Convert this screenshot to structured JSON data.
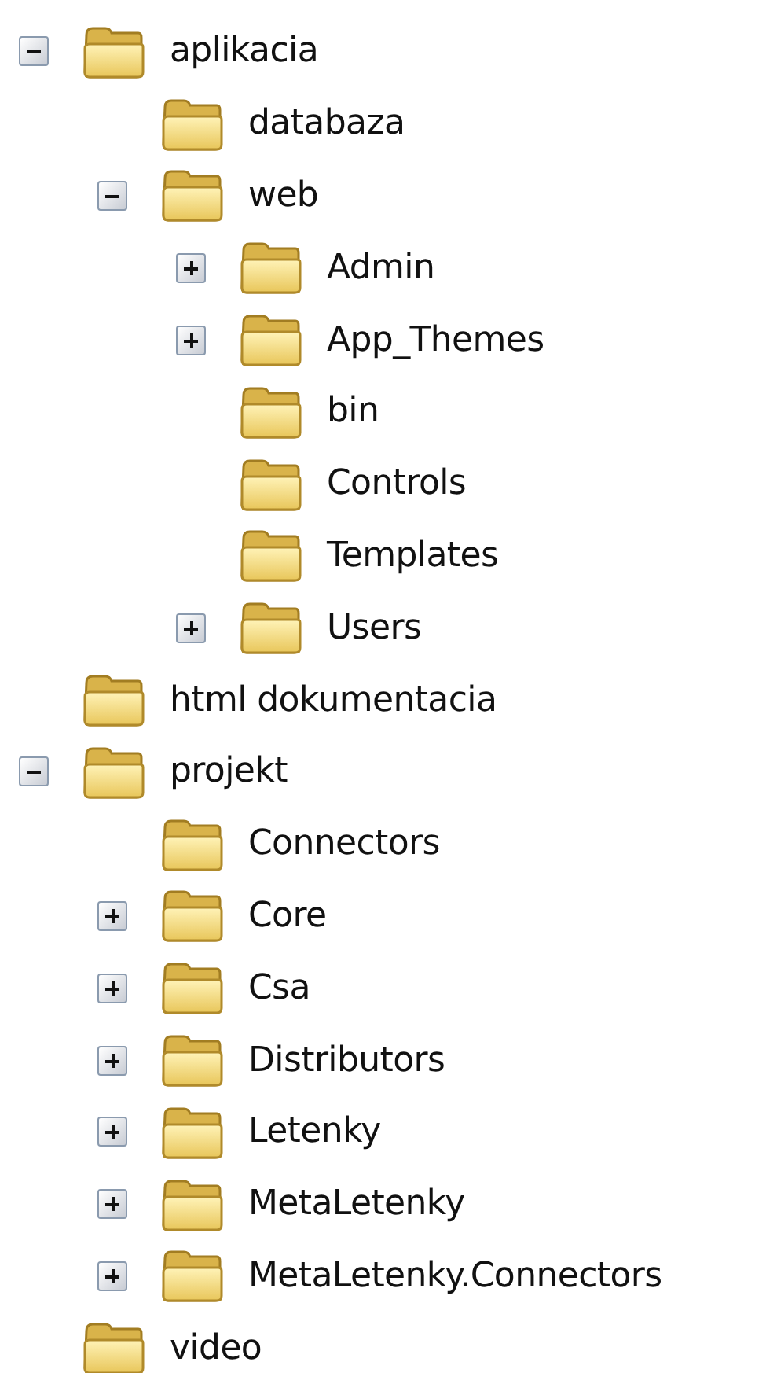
{
  "tree": [
    {
      "label": "aplikacia",
      "expanded": true,
      "children": [
        {
          "label": "databaza"
        },
        {
          "label": "web",
          "expanded": true,
          "children": [
            {
              "label": "Admin",
              "expanded": false
            },
            {
              "label": "App_Themes",
              "expanded": false
            },
            {
              "label": "bin"
            },
            {
              "label": "Controls"
            },
            {
              "label": "Templates"
            },
            {
              "label": "Users",
              "expanded": false
            }
          ]
        }
      ]
    },
    {
      "label": "html dokumentacia"
    },
    {
      "label": "projekt",
      "expanded": true,
      "children": [
        {
          "label": "Connectors"
        },
        {
          "label": "Core",
          "expanded": false
        },
        {
          "label": "Csa",
          "expanded": false
        },
        {
          "label": "Distributors",
          "expanded": false
        },
        {
          "label": "Letenky",
          "expanded": false
        },
        {
          "label": "MetaLetenky",
          "expanded": false
        },
        {
          "label": "MetaLetenky.Connectors",
          "expanded": false
        }
      ]
    },
    {
      "label": "video"
    }
  ]
}
